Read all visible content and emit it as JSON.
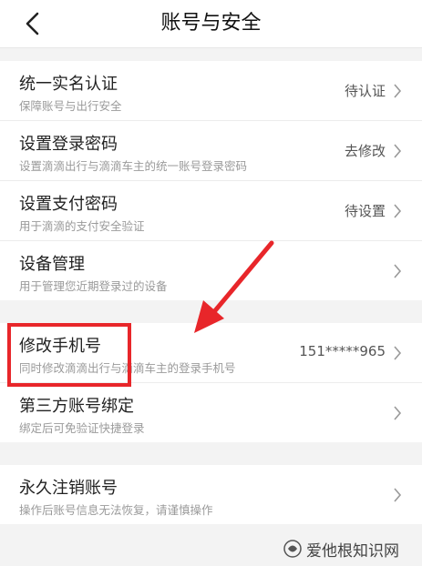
{
  "header": {
    "title": "账号与安全"
  },
  "groups": [
    [
      {
        "label": "统一实名认证",
        "sub": "保障账号与出行安全",
        "value": "待认证"
      },
      {
        "label": "设置登录密码",
        "sub": "设置滴滴出行与滴滴车主的统一账号登录密码",
        "value": "去修改"
      },
      {
        "label": "设置支付密码",
        "sub": "用于滴滴的支付安全验证",
        "value": "待设置"
      },
      {
        "label": "设备管理",
        "sub": "用于管理您近期登录过的设备",
        "value": ""
      }
    ],
    [
      {
        "label": "修改手机号",
        "sub": "同时修改滴滴出行与滴滴车主的登录手机号",
        "value": "151*****965"
      },
      {
        "label": "第三方账号绑定",
        "sub": "绑定后可免验证快捷登录",
        "value": ""
      }
    ],
    [
      {
        "label": "永久注销账号",
        "sub": "操作后账号信息无法恢复，请谨慎操作",
        "value": ""
      }
    ]
  ],
  "watermark": {
    "text": "爱他根知识网"
  },
  "colors": {
    "annotation": "#e8262a",
    "background": "#f3f3f3"
  },
  "icons": {
    "back": "chevron-left-icon",
    "row": "chevron-right-icon"
  }
}
